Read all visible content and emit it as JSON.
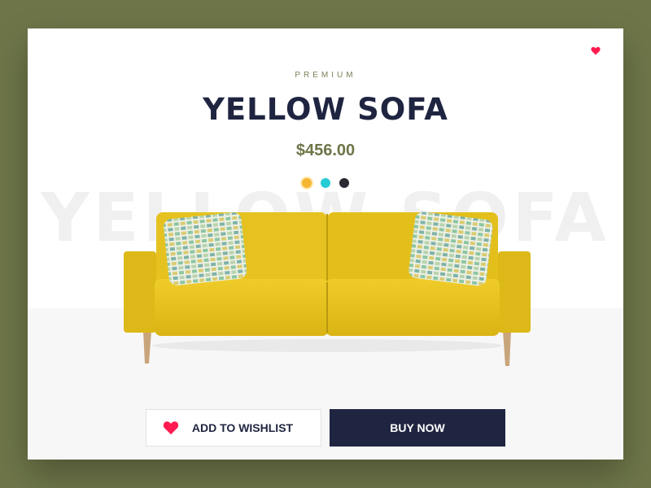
{
  "product": {
    "eyebrow": "PREMIUM",
    "title": "YELLOW SOFA",
    "background_title": "YELLOW SOFA",
    "price": "$456.00"
  },
  "swatches": [
    {
      "color": "#f5b632",
      "selected": true
    },
    {
      "color": "#25ccd6",
      "selected": false
    },
    {
      "color": "#2b2831",
      "selected": false
    }
  ],
  "actions": {
    "wishlist_label": "ADD TO WISHLIST",
    "buy_label": "BUY NOW"
  },
  "icons": {
    "favorite": "heart-icon",
    "wishlist": "heart-icon"
  },
  "colors": {
    "backdrop": "#6e7649",
    "accent": "#ff1a4f",
    "navy": "#1f2540",
    "sofa": "#e8c31c",
    "price": "#6e7649"
  }
}
